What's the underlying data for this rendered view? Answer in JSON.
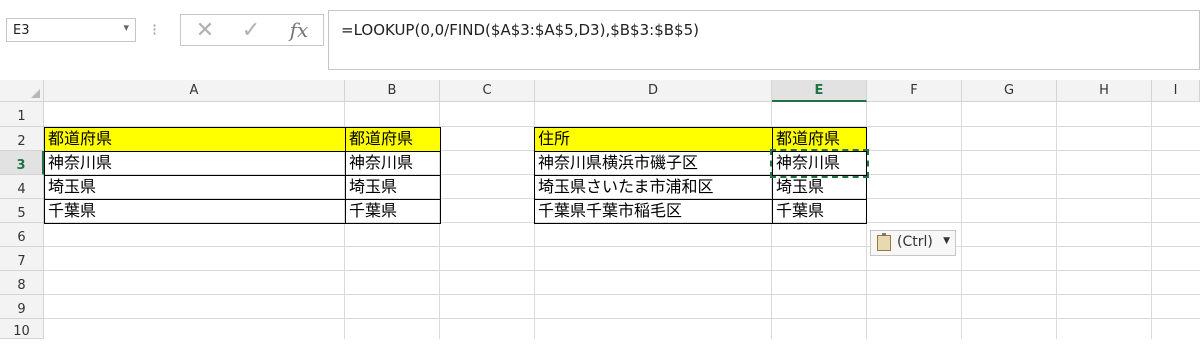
{
  "name_box": "E3",
  "formula_bar": {
    "cancel_icon": "close-icon",
    "enter_icon": "check-icon",
    "fx_label": "fx",
    "formula": "=LOOKUP(0,0/FIND($A$3:$A$5,D3),$B$3:$B$5)"
  },
  "columns": [
    "A",
    "B",
    "C",
    "D",
    "E",
    "F",
    "G",
    "H",
    "I"
  ],
  "rows": [
    "1",
    "2",
    "3",
    "4",
    "5",
    "6",
    "7",
    "8",
    "9",
    "10"
  ],
  "active_cell": "E3",
  "cells": {
    "A2": "都道府県",
    "A3": "神奈川県",
    "A4": "埼玉県",
    "A5": "千葉県",
    "B2": "都道府県",
    "B3": "神奈川県",
    "B4": "埼玉県",
    "B5": "千葉県",
    "D2": "住所",
    "D3": "神奈川県横浜市磯子区",
    "D4": "埼玉県さいたま市浦和区",
    "D5": "千葉県千葉市稲毛区",
    "E2": "都道府県",
    "E3": "神奈川県",
    "E4": "埼玉県",
    "E5": "千葉県"
  },
  "header_fill_color": "#ffff00",
  "paste_options": {
    "label": "(Ctrl)",
    "icon": "clipboard-icon"
  }
}
